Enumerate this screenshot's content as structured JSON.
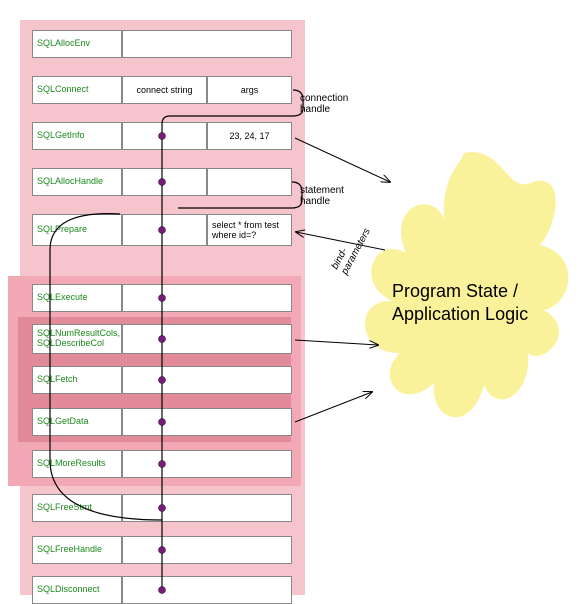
{
  "rows": [
    {
      "fn": "SQLAllocEnv",
      "mid": "",
      "rgt": ""
    },
    {
      "fn": "SQLConnect",
      "mid": "connect string",
      "rgt": "args"
    },
    {
      "fn": "SQLGetInfo",
      "mid": "",
      "rgt": "23, 24, 17"
    },
    {
      "fn": "SQLAllocHandle",
      "mid": "",
      "rgt": ""
    },
    {
      "fn": "SQLPrepare",
      "mid": "",
      "rgt": "select * from test where id=?"
    },
    {
      "fn": "SQLExecute",
      "mid": "",
      "rgt": ""
    },
    {
      "fn": "SQLNumResultCols, SQLDescribeCol",
      "mid": "",
      "rgt": ""
    },
    {
      "fn": "SQLFetch",
      "mid": "",
      "rgt": ""
    },
    {
      "fn": "SQLGetData",
      "mid": "",
      "rgt": ""
    },
    {
      "fn": "SQLMoreResults",
      "mid": "",
      "rgt": ""
    },
    {
      "fn": "SQLFreeStmt",
      "mid": "",
      "rgt": ""
    },
    {
      "fn": "SQLFreeHandle",
      "mid": "",
      "rgt": ""
    },
    {
      "fn": "SQLDisconnect",
      "mid": "",
      "rgt": ""
    }
  ],
  "side_labels": {
    "conn_handle": "connection\nhandle",
    "stmt_handle": "statement\nhandle",
    "bind_params": "bind-\nparameters"
  },
  "blob_text": "Program State /\nApplication Logic",
  "colors": {
    "block": "#f6c4cd",
    "band": "#f2a9b5",
    "band2": "#e38a9a",
    "fn": "#1b8a1b",
    "blob": "#faf29a"
  }
}
